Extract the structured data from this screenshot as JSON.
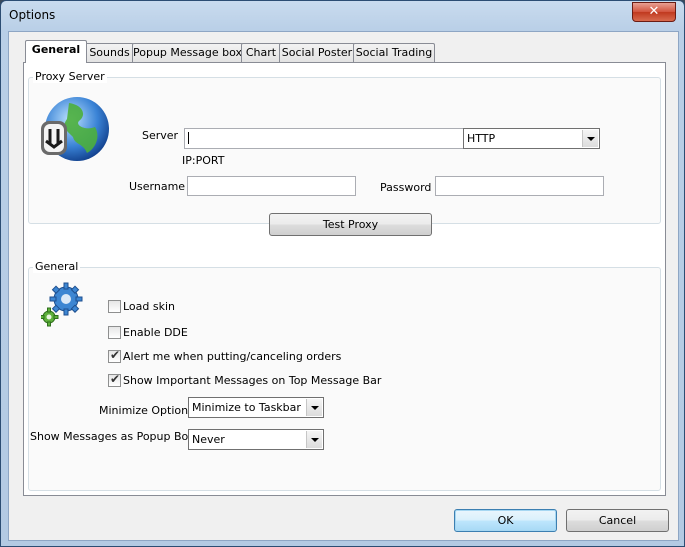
{
  "window": {
    "title": "Options",
    "close_glyph": "✕"
  },
  "tabs": [
    {
      "label": "General",
      "active": true
    },
    {
      "label": "Sounds"
    },
    {
      "label": "Popup Message box"
    },
    {
      "label": "Chart"
    },
    {
      "label": "Social Poster"
    },
    {
      "label": "Social Trading"
    }
  ],
  "proxy": {
    "group_label": "Proxy Server",
    "server_label": "Server",
    "server_value": "",
    "server_hint": "IP:PORT",
    "protocol_value": "HTTP",
    "username_label": "Username",
    "username_value": "",
    "password_label": "Password",
    "password_value": "",
    "test_button": "Test Proxy",
    "icon": "globe-download-icon"
  },
  "general": {
    "group_label": "General",
    "icon": "gears-icon",
    "checkboxes": [
      {
        "label": "Load skin",
        "checked": false
      },
      {
        "label": "Enable DDE",
        "checked": false
      },
      {
        "label": "Alert me when putting/canceling orders",
        "checked": true
      },
      {
        "label": "Show Important Messages on Top Message Bar",
        "checked": true
      }
    ],
    "minimize_label": "Minimize Option",
    "minimize_value": "Minimize to Taskbar",
    "popup_label": "Show Messages as Popup Box",
    "popup_value": "Never"
  },
  "footer": {
    "ok": "OK",
    "cancel": "Cancel"
  },
  "colors": {
    "accent": "#3c7fb1",
    "close": "#c0391f"
  }
}
